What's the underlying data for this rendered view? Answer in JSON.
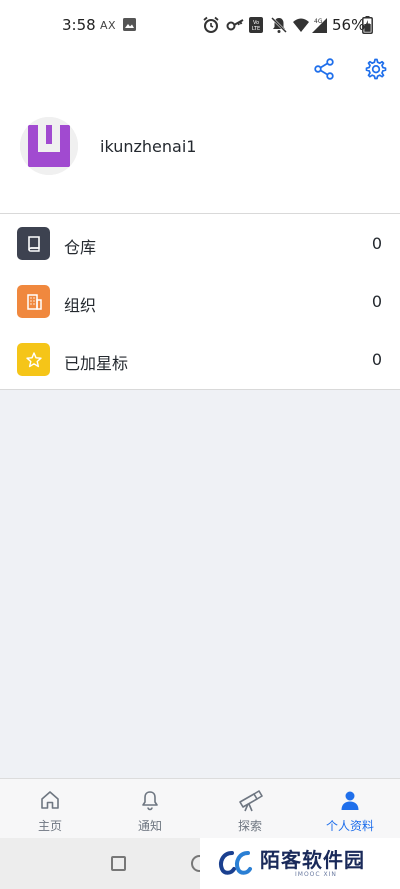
{
  "status_bar": {
    "time": "3:58",
    "indicator": "AX",
    "battery": "56%",
    "icons": [
      "alarm-icon",
      "key-icon",
      "volte-icon",
      "mute-icon",
      "wifi-icon",
      "signal-4g-icon",
      "battery-icon"
    ]
  },
  "app_bar": {
    "actions": [
      "share-icon",
      "settings-icon"
    ]
  },
  "profile": {
    "username": "ikunzhenai1",
    "avatar_color": "#a14ad0"
  },
  "menu": {
    "items": [
      {
        "label": "仓库",
        "count": "0",
        "icon": "repo-icon",
        "color": "#3d4250"
      },
      {
        "label": "组织",
        "count": "0",
        "icon": "organization-icon",
        "color": "#f0883e"
      },
      {
        "label": "已加星标",
        "count": "0",
        "icon": "star-icon",
        "color": "#f5c518"
      }
    ]
  },
  "tabs": [
    {
      "label": "主页",
      "icon": "home-icon",
      "active": false
    },
    {
      "label": "通知",
      "icon": "bell-icon",
      "active": false
    },
    {
      "label": "探索",
      "icon": "telescope-icon",
      "active": false
    },
    {
      "label": "个人资料",
      "icon": "person-icon",
      "active": true
    }
  ],
  "colors": {
    "accent": "#1f6feb",
    "content_bg": "#eff1f5"
  },
  "watermark": {
    "title": "陌客软件园",
    "subtitle": "IMOOC XIN"
  }
}
